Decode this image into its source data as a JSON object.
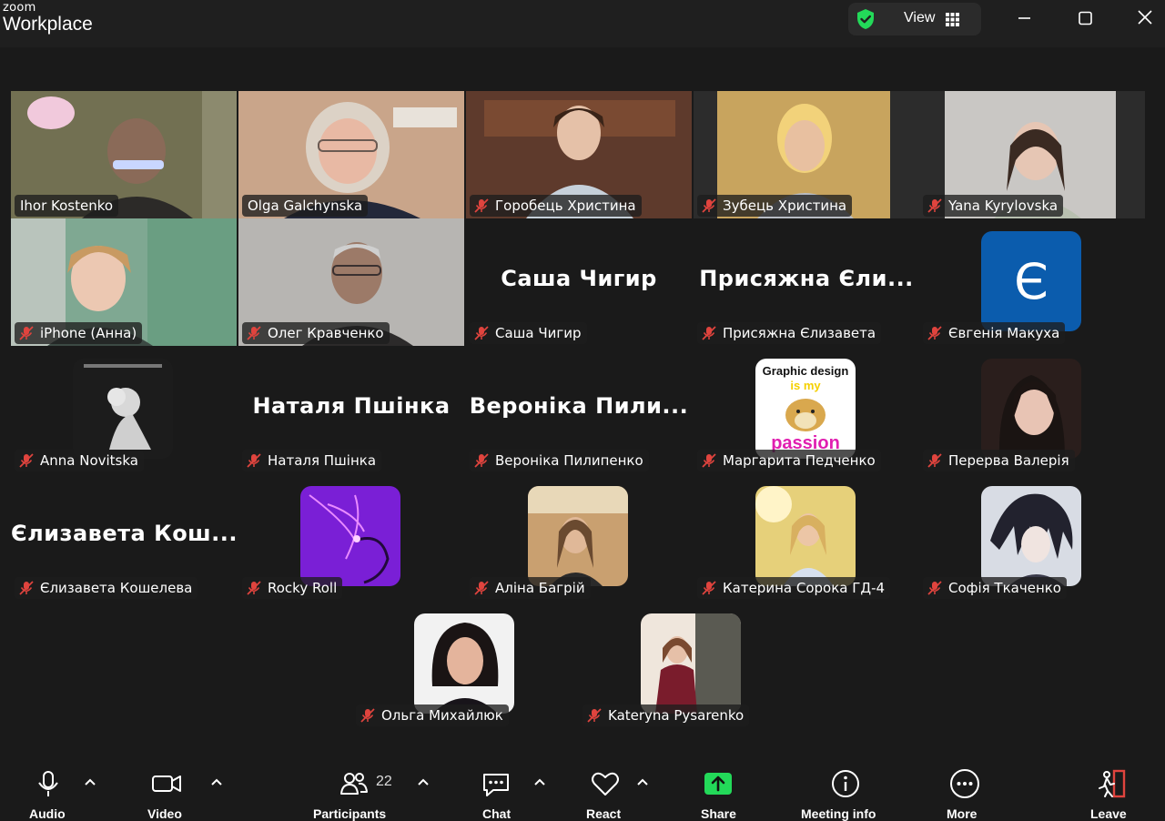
{
  "app": {
    "brand_small": "zoom",
    "brand_name": "Workplace"
  },
  "header": {
    "view_label": "View"
  },
  "tiles": [
    {
      "name": "Ihor Kostenko",
      "kind": "video",
      "muted": false,
      "active": true
    },
    {
      "name": "Olga Galchynska",
      "kind": "video",
      "muted": false
    },
    {
      "name": "Горобець Христина",
      "kind": "video",
      "muted": true
    },
    {
      "name": "Зубець Христина",
      "kind": "video",
      "muted": true
    },
    {
      "name": "Yana Kyrylovska",
      "kind": "video",
      "muted": true
    },
    {
      "name": "iPhone (Анна)",
      "kind": "video",
      "muted": true
    },
    {
      "name": "Олег Кравченко",
      "kind": "video",
      "muted": true
    },
    {
      "name": "Саша Чигир",
      "big": "Саша Чигир",
      "kind": "name",
      "muted": true
    },
    {
      "name": "Присяжна Єлизавета",
      "big": "Присяжна Єли...",
      "kind": "name",
      "muted": true
    },
    {
      "name": "Євгенія Макуха",
      "kind": "letter",
      "letter": "Є",
      "muted": true
    },
    {
      "name": "Anna Novitska",
      "kind": "avatar",
      "muted": true
    },
    {
      "name": "Наталя Пшінка",
      "big": "Наталя Пшінка",
      "kind": "name",
      "muted": true
    },
    {
      "name": "Вероніка Пилипенко",
      "big": "Вероніка Пили...",
      "kind": "name",
      "muted": true
    },
    {
      "name": "Маргарита Педченко",
      "kind": "avatar",
      "muted": true,
      "avatar_text": [
        "Graphic design",
        "is my",
        "passion"
      ]
    },
    {
      "name": "Перерва Валерія",
      "kind": "avatar",
      "muted": true
    },
    {
      "name": "Єлизавета Кошелева",
      "big": "Єлизавета Кош...",
      "kind": "name",
      "muted": true
    },
    {
      "name": "Rocky Roll",
      "kind": "avatar",
      "muted": true
    },
    {
      "name": "Аліна Багрій",
      "kind": "avatar",
      "muted": true
    },
    {
      "name": "Катерина Сорока ГД-4",
      "kind": "avatar",
      "muted": true
    },
    {
      "name": "Софія Ткаченко",
      "kind": "avatar",
      "muted": true
    },
    {
      "name": "Ольга Михайлюк",
      "kind": "avatar",
      "muted": true
    },
    {
      "name": "Kateryna Pysarenko",
      "kind": "avatar",
      "muted": true
    }
  ],
  "toolbar": {
    "audio": "Audio",
    "video": "Video",
    "participants": "Participants",
    "participants_count": "22",
    "chat": "Chat",
    "react": "React",
    "share": "Share",
    "meeting_info": "Meeting info",
    "more": "More",
    "leave": "Leave"
  },
  "colors": {
    "active_border": "#23d959",
    "share_green": "#23d959",
    "mic_off_red": "#e0443e",
    "leave_red": "#e0443e",
    "letter_tile_blue": "#0b5cad"
  },
  "icons": [
    "shield-check-icon",
    "grid-icon",
    "minimize-icon",
    "maximize-icon",
    "close-icon",
    "mic-icon",
    "video-camera-icon",
    "participants-icon",
    "chat-icon",
    "heart-icon",
    "share-screen-icon",
    "info-icon",
    "more-icon",
    "leave-icon",
    "mic-off-icon"
  ]
}
